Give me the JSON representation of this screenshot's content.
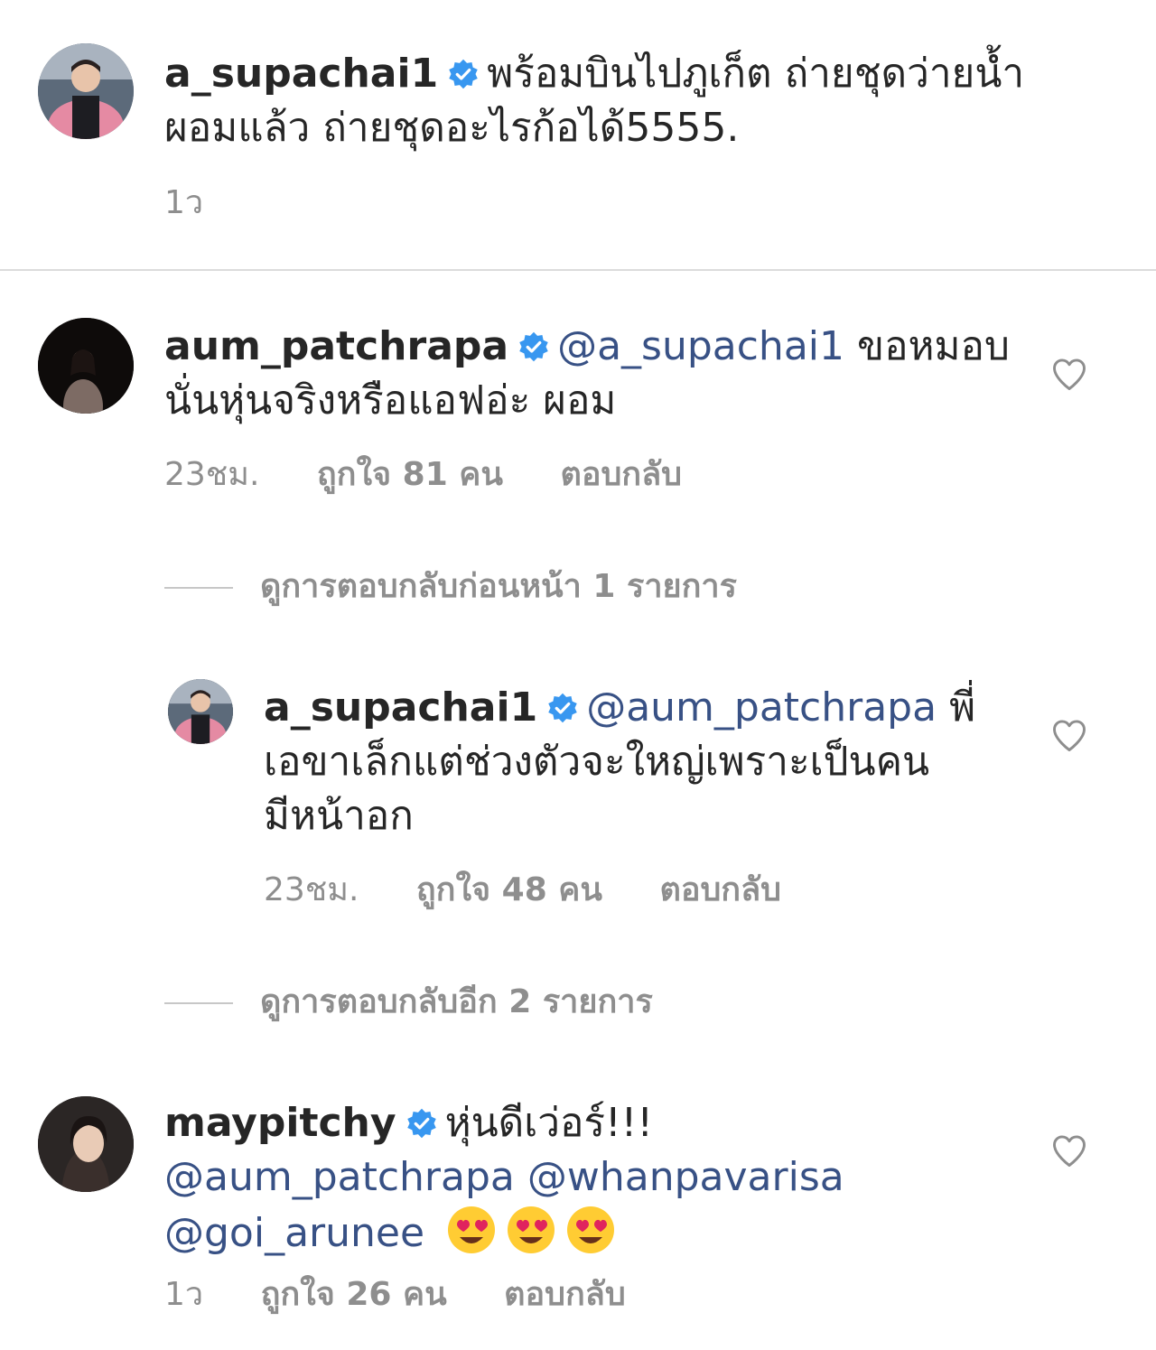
{
  "post_caption": {
    "username": "a_supachai1",
    "text": "พร้อมบินไปภูเก็ต ถ่ายชุดว่ายน้ำผอมแล้ว ถ่ายชุดอะไรก้อได้5555.",
    "time": "1ว"
  },
  "comments": [
    {
      "username": "aum_patchrapa",
      "mention": "@a_supachai1",
      "text": "ขอหมอบ นั่นหุ่นจริงหรือแอฟอ่ะ ผอม",
      "time": "23ชม.",
      "likes": "ถูกใจ 81 คน",
      "reply_label": "ตอบกลับ",
      "view_replies": "ดูการตอบกลับก่อนหน้า 1 รายการ"
    },
    {
      "username": "a_supachai1",
      "mention": "@aum_patchrapa",
      "text": "พี่เอขาเล็กแต่ช่วงตัวจะใหญ่เพราะเป็นคนมีหน้าอก",
      "time": "23ชม.",
      "likes": "ถูกใจ 48 คน",
      "reply_label": "ตอบกลับ",
      "view_replies": "ดูการตอบกลับอีก 2 รายการ"
    },
    {
      "username": "maypitchy",
      "text": "หุ่นดีเว่อร์!!!",
      "mentions": [
        "@aum_patchrapa",
        "@whanpavarisa",
        "@goi_arunee"
      ],
      "time": "1ว",
      "likes": "ถูกใจ 26 คน",
      "reply_label": "ตอบกลับ"
    }
  ],
  "icons": {
    "verified": "verified-badge-icon",
    "like": "heart-outline-icon",
    "emoji": "heart-eyes-emoji"
  },
  "colors": {
    "text": "#262626",
    "secondary": "#8e8e8e",
    "mention": "#385185",
    "verified": "#3897f0"
  }
}
